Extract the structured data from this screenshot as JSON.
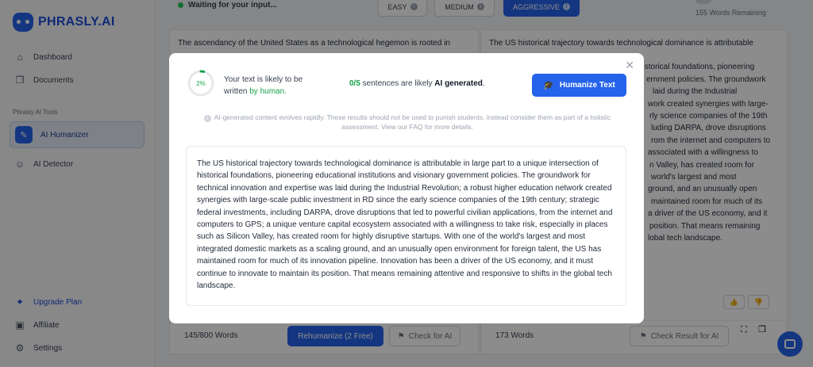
{
  "app": {
    "logo_text": "PHRASLY.AI"
  },
  "sidebar": {
    "items": [
      {
        "label": "Dashboard",
        "icon": "home-icon"
      },
      {
        "label": "Documents",
        "icon": "documents-icon"
      }
    ],
    "section_label": "Phrasly AI Tools",
    "tools": [
      {
        "label": "AI Humanizer",
        "icon": "pencil-icon",
        "active": true
      },
      {
        "label": "AI Detector",
        "icon": "robot-icon",
        "active": false
      }
    ],
    "bottom": [
      {
        "label": "Upgrade Plan",
        "icon": "sparkle-icon"
      },
      {
        "label": "Affiliate",
        "icon": "id-card-icon"
      },
      {
        "label": "Settings",
        "icon": "gear-icon"
      }
    ]
  },
  "editor": {
    "status": "Waiting for your input...",
    "modes": [
      {
        "label": "EASY",
        "active": false
      },
      {
        "label": "MEDIUM",
        "active": false
      },
      {
        "label": "AGGRESSIVE",
        "active": true
      }
    ],
    "words_remaining": "155 Words Remaining",
    "left_text": "The ascendancy of the United States as a technological hegemon is rooted in",
    "right_text_visible": [
      "The US historical trajectory towards technological dominance is attributable",
      "",
      "historical foundations, pioneering",
      "ernment policies. The groundwork",
      "laid during the Industrial",
      "work created synergies with large-",
      "rly science companies of the 19th",
      "luding DARPA, drove disruptions",
      "rom the internet and computers to",
      "associated with a willingness to",
      "n Valley, has created room for",
      "world's largest and most",
      "ground, and an unusually open",
      "maintained room for much of its",
      "a driver of the US economy, and it",
      "position. That means remaining",
      "lobal tech landscape."
    ],
    "left_word_count": "145",
    "left_word_limit": "/800 Words",
    "rehumanize_label": "Rehumanize (2 Free)",
    "check_label": "Check for AI",
    "right_word_count": "173 Words",
    "check_result_label": "Check Result for AI"
  },
  "modal": {
    "percent": "2%",
    "percent_value": 0.02,
    "likely_prefix": "Your text is likely to be written ",
    "likely_highlight": "by human.",
    "sentences_fraction": "0/5",
    "sentences_mid": " sentences are likely ",
    "sentences_bold": "AI generated",
    "sentences_end": ".",
    "humanize_label": "Humanize Text",
    "disclaimer": "AI-generated content evolves rapidly. These results should not be used to punish students, instead consider them as part of a holistic assessment. View our FAQ for more details.",
    "result_text": "The US historical trajectory towards technological dominance is attributable in large part to a unique intersection of historical foundations, pioneering educational institutions and visionary government policies. The groundwork for technical innovation and expertise was laid during the Industrial Revolution; a robust higher education network created synergies with large-scale public investment in RD since the early science companies of the 19th century; strategic federal investments, including DARPA, drove disruptions that led to powerful civilian applications, from the internet and computers to GPS; a unique venture capital ecosystem associated with a willingness to take risk, especially in places such as Silicon Valley, has created room for highly disruptive startups. With one of the world's largest and most integrated domestic markets as a scaling ground, and an unusually open environment for foreign talent, the US has maintained room for much of its innovation pipeline. Innovation has been a driver of the US economy, and it must continue to innovate to maintain its position. That means remaining attentive and responsive to shifts in the global tech landscape."
  },
  "colors": {
    "accent": "#2563eb",
    "human_green": "#16a34a"
  }
}
